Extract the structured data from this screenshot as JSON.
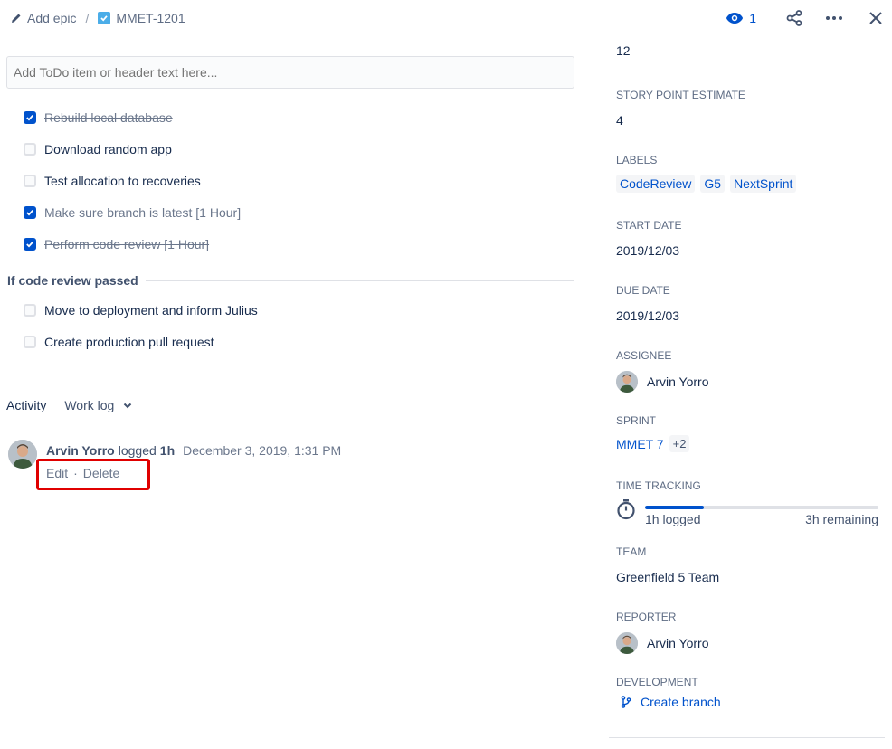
{
  "header": {
    "add_epic_label": "Add epic",
    "separator": "/",
    "issue_key": "MMET-1201",
    "watch_count": "1"
  },
  "todo": {
    "input_placeholder": "Add ToDo item or header text here...",
    "items": [
      {
        "text": "Rebuild local database",
        "checked": true
      },
      {
        "text": "Download random app",
        "checked": false
      },
      {
        "text": "Test allocation to recoveries",
        "checked": false
      },
      {
        "text": "Make sure branch is latest [1 Hour]",
        "checked": true
      },
      {
        "text": "Perform code review [1 Hour]",
        "checked": true
      }
    ],
    "section_header": "If code review passed",
    "section_items": [
      {
        "text": "Move to deployment and inform Julius",
        "checked": false
      },
      {
        "text": "Create production pull request",
        "checked": false
      }
    ]
  },
  "activity": {
    "label": "Activity",
    "filter": "Work log",
    "entry": {
      "author": "Arvin Yorro",
      "verb": "logged",
      "amount": "1h",
      "date": "December 3, 2019, 1:31 PM",
      "edit": "Edit",
      "dot": "·",
      "delete": "Delete"
    }
  },
  "sidebar": {
    "top_value": "12",
    "story_points": {
      "label": "STORY POINT ESTIMATE",
      "value": "4"
    },
    "labels": {
      "label": "LABELS",
      "tags": [
        "CodeReview",
        "G5",
        "NextSprint"
      ]
    },
    "start_date": {
      "label": "START DATE",
      "value": "2019/12/03"
    },
    "due_date": {
      "label": "DUE DATE",
      "value": "2019/12/03"
    },
    "assignee": {
      "label": "ASSIGNEE",
      "value": "Arvin Yorro"
    },
    "sprint": {
      "label": "SPRINT",
      "value": "MMET 7",
      "more": "+2"
    },
    "time_tracking": {
      "label": "TIME TRACKING",
      "logged": "1h logged",
      "remaining": "3h remaining",
      "progress_fraction": 0.25
    },
    "team": {
      "label": "TEAM",
      "value": "Greenfield 5 Team"
    },
    "reporter": {
      "label": "REPORTER",
      "value": "Arvin Yorro"
    },
    "development": {
      "label": "DEVELOPMENT",
      "action": "Create branch"
    }
  },
  "colors": {
    "accent": "#0052cc",
    "highlight": "#e00000"
  }
}
